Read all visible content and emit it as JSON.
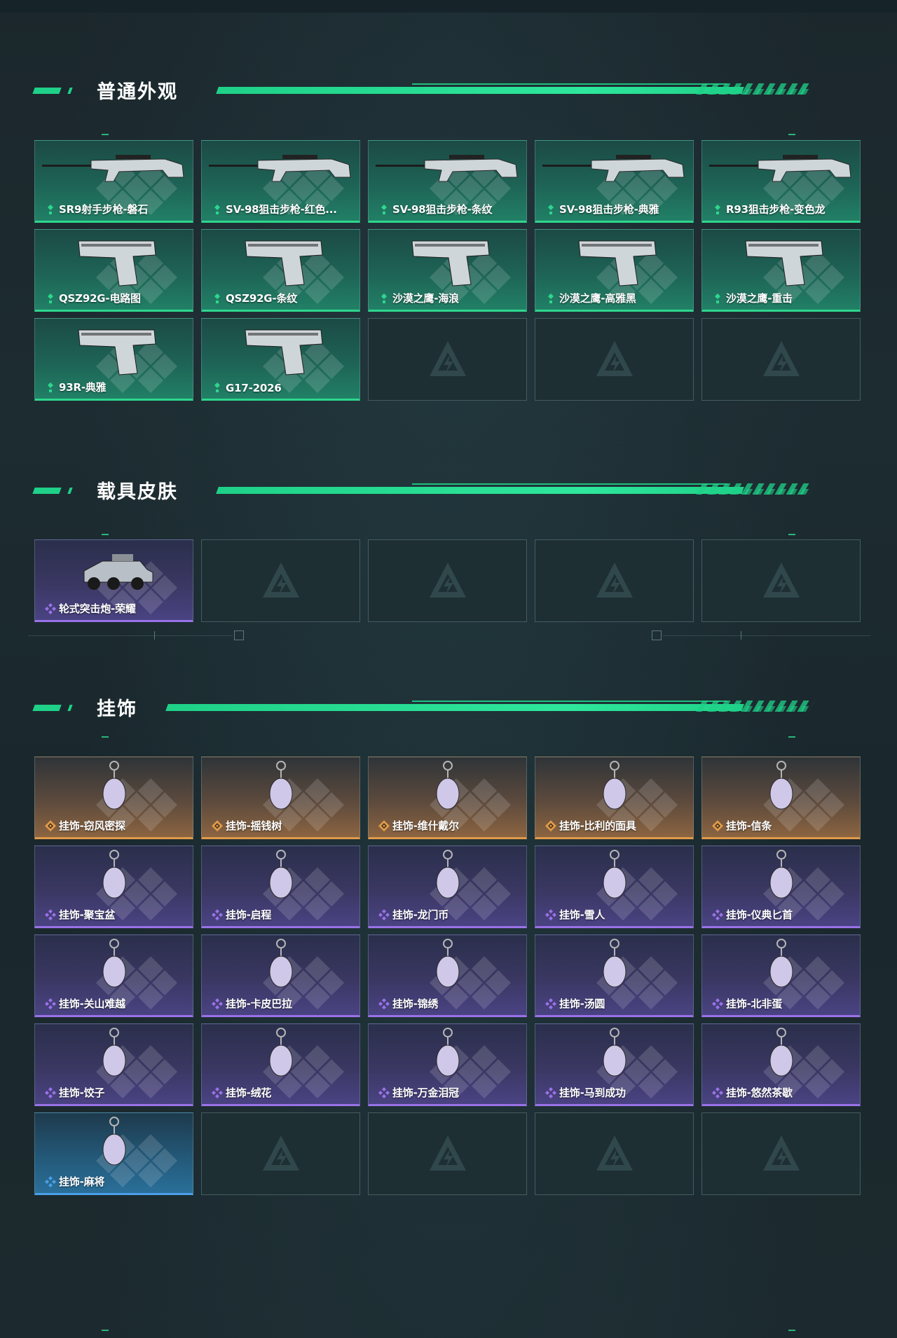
{
  "colors": {
    "accent_green": "#1fd188",
    "rarity_green": "#2ed68d",
    "rarity_purple": "#9a72e8",
    "rarity_orange": "#e09a4a",
    "rarity_blue": "#4aa0e8"
  },
  "sections": [
    {
      "title": "普通外观",
      "items": [
        {
          "name": "SR9射手步枪-磐石",
          "rarity": "green",
          "icon": "rifle-icon"
        },
        {
          "name": "SV-98狙击步枪-红色...",
          "rarity": "green",
          "icon": "sniper-rifle-icon"
        },
        {
          "name": "SV-98狙击步枪-条纹",
          "rarity": "green",
          "icon": "sniper-rifle-icon"
        },
        {
          "name": "SV-98狙击步枪-典雅",
          "rarity": "green",
          "icon": "sniper-rifle-icon"
        },
        {
          "name": "R93狙击步枪-变色龙",
          "rarity": "green",
          "icon": "sniper-rifle-icon"
        },
        {
          "name": "QSZ92G-电路图",
          "rarity": "green",
          "icon": "pistol-icon"
        },
        {
          "name": "QSZ92G-条纹",
          "rarity": "green",
          "icon": "pistol-icon"
        },
        {
          "name": "沙漠之鹰-海浪",
          "rarity": "green",
          "icon": "pistol-icon"
        },
        {
          "name": "沙漠之鹰-高雅黑",
          "rarity": "green",
          "icon": "pistol-icon"
        },
        {
          "name": "沙漠之鹰-重击",
          "rarity": "green",
          "icon": "pistol-icon"
        },
        {
          "name": "93R-典雅",
          "rarity": "green",
          "icon": "pistol-icon"
        },
        {
          "name": "G17-2026",
          "rarity": "green",
          "icon": "pistol-icon"
        }
      ]
    },
    {
      "title": "载具皮肤",
      "items": [
        {
          "name": "轮式突击炮-荣耀",
          "rarity": "purple",
          "icon": "vehicle-icon"
        }
      ]
    },
    {
      "title": "挂饰",
      "items": [
        {
          "name": "挂饰-窃风密探",
          "rarity": "orange",
          "icon": "charm-icon"
        },
        {
          "name": "挂饰-摇钱树",
          "rarity": "orange",
          "icon": "charm-icon"
        },
        {
          "name": "挂饰-维什戴尔",
          "rarity": "orange",
          "icon": "charm-icon"
        },
        {
          "name": "挂饰-比利的面具",
          "rarity": "orange",
          "icon": "charm-icon"
        },
        {
          "name": "挂饰-信条",
          "rarity": "orange",
          "icon": "charm-icon"
        },
        {
          "name": "挂饰-聚宝盆",
          "rarity": "purple",
          "icon": "charm-icon"
        },
        {
          "name": "挂饰-启程",
          "rarity": "purple",
          "icon": "charm-icon"
        },
        {
          "name": "挂饰-龙门币",
          "rarity": "purple",
          "icon": "charm-icon"
        },
        {
          "name": "挂饰-雪人",
          "rarity": "purple",
          "icon": "charm-icon"
        },
        {
          "name": "挂饰-仪典匕首",
          "rarity": "purple",
          "icon": "charm-icon"
        },
        {
          "name": "挂饰-关山难越",
          "rarity": "purple",
          "icon": "charm-icon"
        },
        {
          "name": "挂饰-卡皮巴拉",
          "rarity": "purple",
          "icon": "charm-icon"
        },
        {
          "name": "挂饰-锦绣",
          "rarity": "purple",
          "icon": "charm-icon"
        },
        {
          "name": "挂饰-汤圆",
          "rarity": "purple",
          "icon": "charm-icon"
        },
        {
          "name": "挂饰-北非蛋",
          "rarity": "purple",
          "icon": "charm-icon"
        },
        {
          "name": "挂饰-饺子",
          "rarity": "purple",
          "icon": "charm-icon"
        },
        {
          "name": "挂饰-绒花",
          "rarity": "purple",
          "icon": "charm-icon"
        },
        {
          "name": "挂饰-万金泪冠",
          "rarity": "purple",
          "icon": "charm-icon"
        },
        {
          "name": "挂饰-马到成功",
          "rarity": "purple",
          "icon": "charm-icon"
        },
        {
          "name": "挂饰-悠然茶歇",
          "rarity": "purple",
          "icon": "charm-icon"
        },
        {
          "name": "挂饰-麻将",
          "rarity": "blue",
          "icon": "charm-icon"
        }
      ]
    }
  ]
}
